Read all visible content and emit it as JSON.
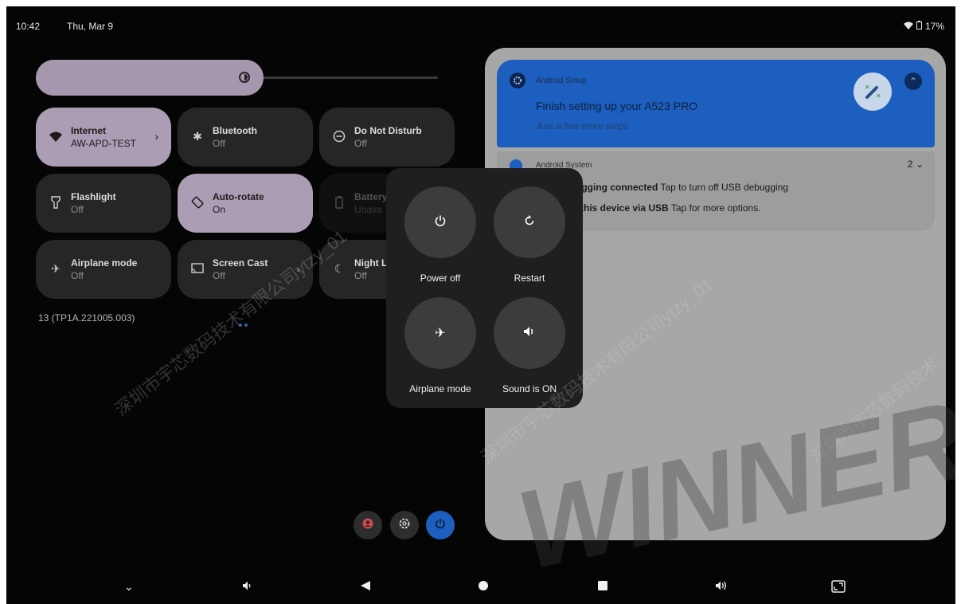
{
  "status": {
    "time": "10:42",
    "date": "Thu, Mar 9",
    "battery": "17%"
  },
  "tiles": [
    {
      "title": "Internet",
      "subtitle": "AW-APD-TEST"
    },
    {
      "title": "Bluetooth",
      "subtitle": "Off"
    },
    {
      "title": "Do Not Disturb",
      "subtitle": "Off"
    },
    {
      "title": "Flashlight",
      "subtitle": "Off"
    },
    {
      "title": "Auto-rotate",
      "subtitle": "On"
    },
    {
      "title": "Battery",
      "subtitle": "Unava"
    },
    {
      "title": "Airplane mode",
      "subtitle": "Off"
    },
    {
      "title": "Screen Cast",
      "subtitle": "Off"
    },
    {
      "title": "Night L",
      "subtitle": "Off"
    }
  ],
  "build": "13 (TP1A.221005.003)",
  "notifications": {
    "setup": {
      "app": "Android Setup",
      "title": "Finish setting up your A523 PRO",
      "subtitle": "Just a few more steps"
    },
    "system": {
      "app": "Android System",
      "count": "2",
      "line1_bold": "USB debugging connected",
      "line1_rest": " Tap to turn off USB debugging",
      "line2_bold": "Charging this device via USB",
      "line2_rest": " Tap for more options."
    }
  },
  "power_menu": {
    "power_off": "Power off",
    "restart": "Restart",
    "airplane": "Airplane mode",
    "sound": "Sound is ON"
  },
  "watermark": {
    "text1": "深圳市宇芯数码技术有限公司ytzy_01",
    "text2": "深圳市宇芯数码技术",
    "brand": "WINNER"
  }
}
